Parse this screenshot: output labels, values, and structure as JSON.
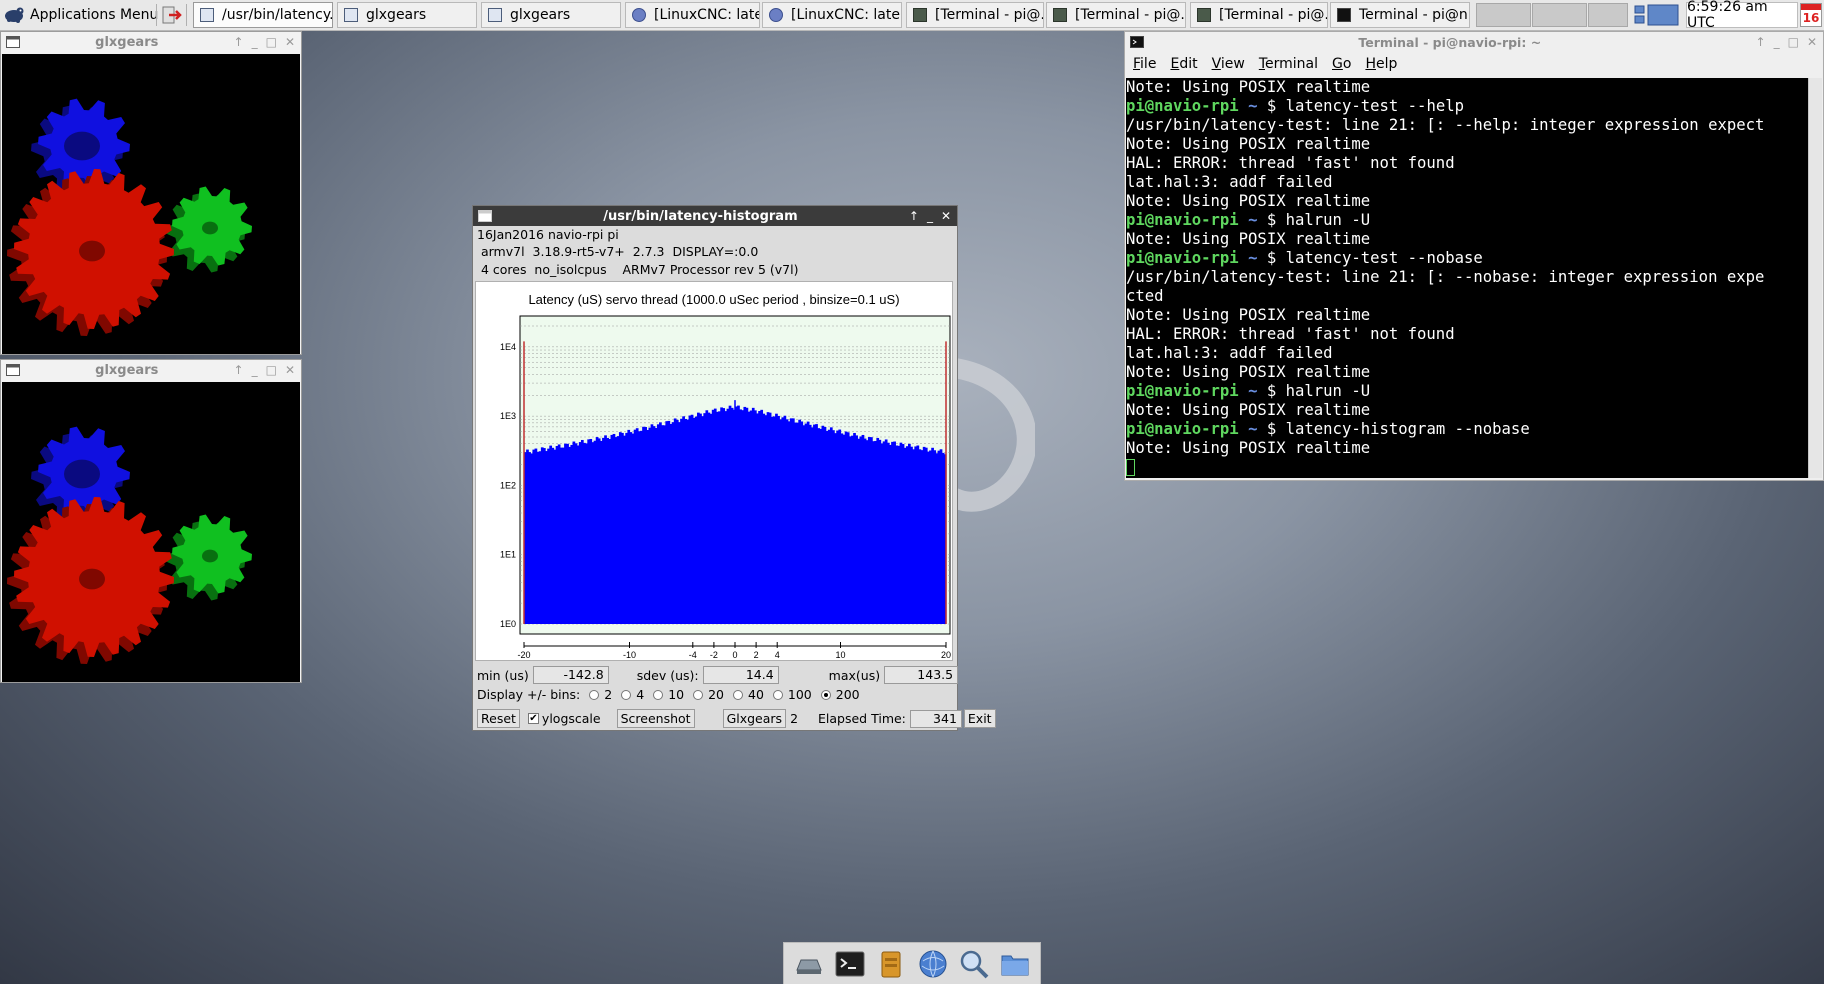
{
  "panel": {
    "app_menu_label": "Applications Menu",
    "tasks": [
      {
        "label": "/usr/bin/latency...",
        "icon": "window-icon",
        "active": true
      },
      {
        "label": "glxgears",
        "icon": "window-icon"
      },
      {
        "label": "glxgears",
        "icon": "window-icon"
      },
      {
        "label": "[LinuxCNC: late...",
        "icon": "linuxcnc-icon"
      },
      {
        "label": "[LinuxCNC: late...",
        "icon": "linuxcnc-icon"
      },
      {
        "label": "[Terminal - pi@...",
        "icon": "terminal-icon"
      },
      {
        "label": "[Terminal - pi@...",
        "icon": "terminal-icon"
      },
      {
        "label": "[Terminal - pi@...",
        "icon": "terminal-icon"
      },
      {
        "label": "Terminal - pi@n...",
        "icon": "terminal-icon"
      }
    ],
    "clock": "6:59:26 am UTC",
    "calendar_day": "16"
  },
  "glxgears_windows": [
    {
      "title": "glxgears"
    },
    {
      "title": "glxgears"
    }
  ],
  "histogram": {
    "title": "/usr/bin/latency-histogram",
    "info_line1": "16Jan2016 navio-rpi pi",
    "info_line2": " armv7l  3.18.9-rt5-v7+  2.7.3  DISPLAY=:0.0",
    "info_line3": " 4 cores  no_isolcpus    ARMv7 Processor rev 5 (v7l)",
    "min_label": "min (us)",
    "min_value": "-142.8",
    "sdev_label": "sdev (us):",
    "sdev_value": "14.4",
    "max_label": "max(us)",
    "max_value": "143.5",
    "bins_label": "Display +/- bins:",
    "bin_options": [
      "2",
      "4",
      "10",
      "20",
      "40",
      "100",
      "200"
    ],
    "bin_selected": "200",
    "reset_label": "Reset",
    "ylogscale_label": "ylogscale",
    "ylogscale_checked": true,
    "screenshot_label": "Screenshot",
    "glxgears_label": "Glxgears",
    "glxgears_count": "2",
    "elapsed_label": "Elapsed Time:",
    "elapsed_value": "341",
    "exit_label": "Exit"
  },
  "chart_data": {
    "type": "bar",
    "title": "Latency (uS) servo thread (1000.0 uSec period , binsize=0.1 uS)",
    "xlabel": "",
    "ylabel": "",
    "y_scale": "log",
    "ylim": [
      1,
      20000
    ],
    "xlim": [
      -20,
      20
    ],
    "x_tick_labels": [
      "-20",
      "-10",
      "-4",
      "-2",
      "0",
      "2",
      "4",
      "10",
      "20"
    ],
    "x_ticks": [
      -20,
      -10,
      -4,
      -2,
      0,
      2,
      4,
      10,
      20
    ],
    "y_tick_labels": [
      "1E0",
      "1E1",
      "1E2",
      "1E3",
      "1E4"
    ],
    "y_ticks": [
      1,
      10,
      100,
      1000,
      10000
    ],
    "envelope": {
      "x": [
        -20,
        -16,
        -12,
        -8,
        -4,
        -2,
        0,
        2,
        4,
        8,
        12,
        16,
        20
      ],
      "y": [
        300,
        380,
        500,
        700,
        1000,
        1200,
        1350,
        1200,
        1000,
        700,
        500,
        380,
        300
      ]
    },
    "outlier_spikes": [
      {
        "x": -20,
        "y": 12000
      },
      {
        "x": 20,
        "y": 12000
      },
      {
        "x": 0,
        "y": 1700
      },
      {
        "x": 5.5,
        "y": 200
      },
      {
        "x": -19,
        "y": 150
      }
    ],
    "bar_color": "#0000ff",
    "spike_color": "#c03030",
    "plot_bg": "#eefaee",
    "grid": true
  },
  "terminal": {
    "title": "Terminal - pi@navio-rpi: ~",
    "menu": [
      "File",
      "Edit",
      "View",
      "Terminal",
      "Go",
      "Help"
    ],
    "menu_mnemonic": [
      "F",
      "E",
      "V",
      "T",
      "G",
      "H"
    ],
    "lines": [
      {
        "text": "Note: Using POSIX realtime"
      },
      {
        "prompt": "pi@navio-rpi",
        "tilde": "~",
        "cmd": " $ latency-test --help"
      },
      {
        "text": "/usr/bin/latency-test: line 21: [: --help: integer expression expect"
      },
      {
        "text": "Note: Using POSIX realtime"
      },
      {
        "text": "HAL: ERROR: thread 'fast' not found"
      },
      {
        "text": "lat.hal:3: addf failed"
      },
      {
        "text": "Note: Using POSIX realtime"
      },
      {
        "prompt": "pi@navio-rpi",
        "tilde": "~",
        "cmd": " $ halrun -U"
      },
      {
        "text": "Note: Using POSIX realtime"
      },
      {
        "prompt": "pi@navio-rpi",
        "tilde": "~",
        "cmd": " $ latency-test --nobase"
      },
      {
        "text": "/usr/bin/latency-test: line 21: [: --nobase: integer expression expe"
      },
      {
        "text": "cted"
      },
      {
        "text": "Note: Using POSIX realtime"
      },
      {
        "text": "HAL: ERROR: thread 'fast' not found"
      },
      {
        "text": "lat.hal:3: addf failed"
      },
      {
        "text": "Note: Using POSIX realtime"
      },
      {
        "prompt": "pi@navio-rpi",
        "tilde": "~",
        "cmd": " $ halrun -U"
      },
      {
        "text": "Note: Using POSIX realtime"
      },
      {
        "prompt": "pi@navio-rpi",
        "tilde": "~",
        "cmd": " $ latency-histogram --nobase"
      },
      {
        "text": "Note: Using POSIX realtime"
      },
      {
        "cursor": true
      }
    ]
  },
  "dock": [
    "show-desktop-icon",
    "terminal-icon",
    "file-manager-icon",
    "web-browser-icon",
    "app-finder-icon",
    "folder-icon"
  ]
}
